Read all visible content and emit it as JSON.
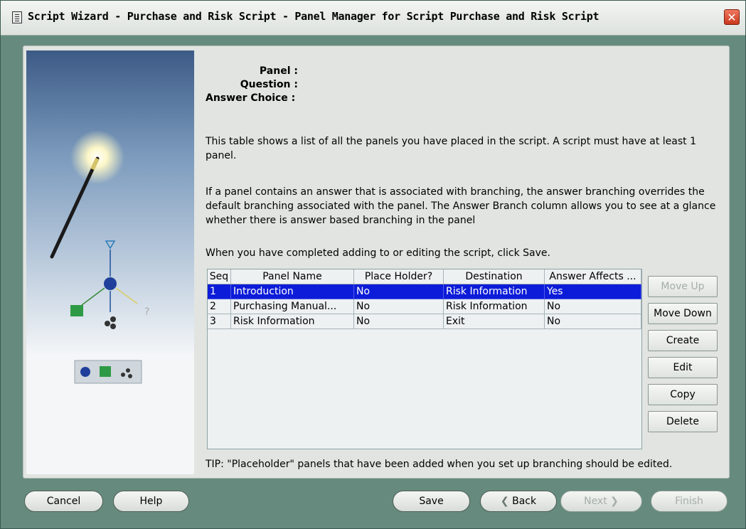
{
  "window": {
    "title": "Script Wizard - Purchase and Risk Script - Panel Manager for Script Purchase and Risk Script"
  },
  "fields": {
    "panel": "Panel :",
    "question": "Question :",
    "answer_choice": "Answer Choice :"
  },
  "text": {
    "p1": "This table shows a list of all the panels you have placed in the script.  A script must have at least 1 panel.",
    "p2": "If a panel contains an answer that is associated with branching, the answer branching overrides the default branching associated with the panel.  The Answer Branch column allows you to see at a glance whether there is answer based branching in the panel",
    "p3": "When you have completed adding to or editing the script, click Save.",
    "tip": "TIP: \"Placeholder\" panels that have been added when you set up branching should be edited."
  },
  "table": {
    "headers": [
      "Seq",
      "Panel Name",
      "Place Holder?",
      "Destination",
      "Answer Affects ..."
    ],
    "rows": [
      [
        "1",
        "Introduction",
        "No",
        "Risk Information",
        "Yes"
      ],
      [
        "2",
        "Purchasing Manual...",
        "No",
        "Risk Information",
        "No"
      ],
      [
        "3",
        "Risk Information",
        "No",
        "Exit",
        "No"
      ]
    ],
    "selected_row": 0
  },
  "side_buttons": {
    "move_up": "Move Up",
    "move_down": "Move Down",
    "create": "Create",
    "edit": "Edit",
    "copy": "Copy",
    "delete": "Delete"
  },
  "bottom_buttons": {
    "cancel": "Cancel",
    "help": "Help",
    "save": "Save",
    "back": "Back",
    "next": "Next",
    "finish": "Finish"
  },
  "colors": {
    "selection": "#0d1cd8",
    "frame": "#668a7e"
  }
}
